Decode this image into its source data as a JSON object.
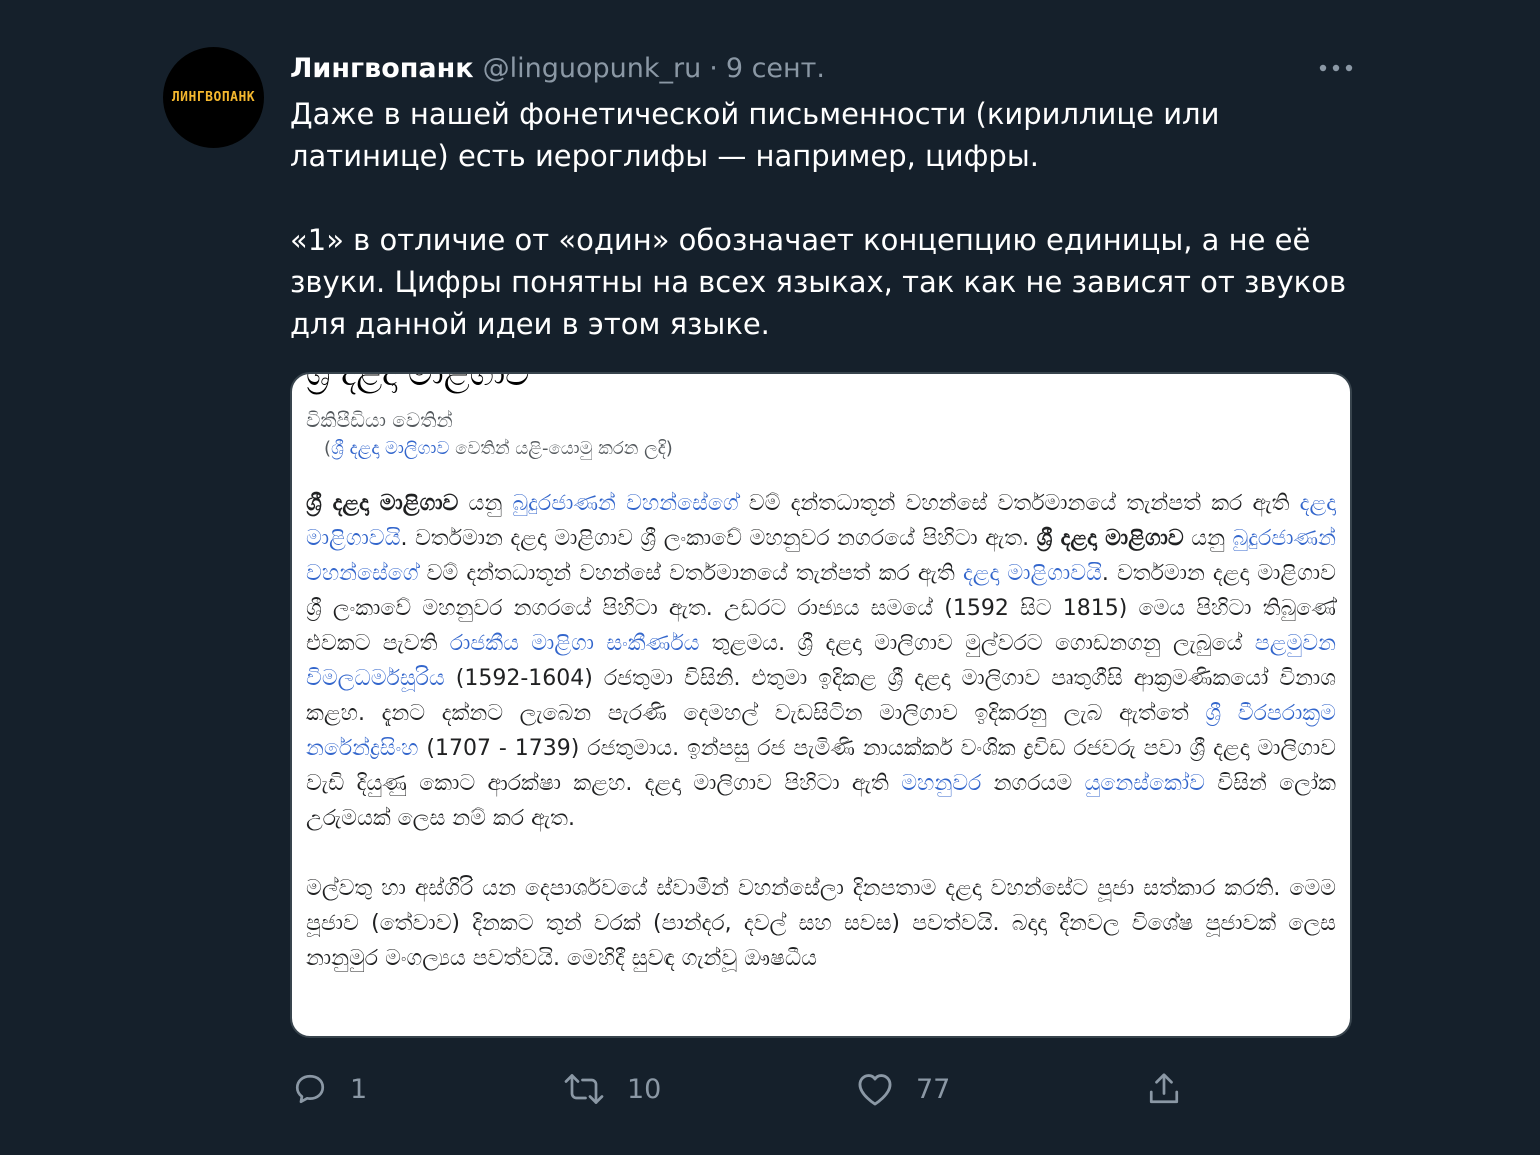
{
  "tweet": {
    "avatar_text": "ЛИНГВОПАНК",
    "author_name": "Лингвопанк",
    "handle": "@linguopunk_ru",
    "separator": "·",
    "date": "9 сент.",
    "more_icon": "more-horizontal-icon",
    "paragraphs": [
      "Даже в нашей фонетической письменности (кириллице или латинице) есть иероглифы — например, цифры.",
      "«1» в отличие от «один» обозначает концепцию единицы, а не её звуки. Цифры понятны на всех языках, так как не зависят от звуков для данной идеи в этом языке."
    ]
  },
  "media": {
    "heading_partial": "ශ්‍රී දළදා මාළිගාව",
    "from_line": "විකිපීඩියා වෙතින්",
    "redirect": {
      "open": "(",
      "link": "ශ්‍රී දළදා මාලිගාව",
      "rest": " වෙතින් යළි-යොමු කරන ලදි)"
    },
    "p1": {
      "s1": "ශ්‍රී දළදා මාළිගාව",
      "s2": " යනු ",
      "s3": "බුදුරජාණන් වහන්සේගේ",
      "s4": " වම් දන්තධාතූන් වහන්සේ වර්තමානයේ තැන්පත් කර ඇති ",
      "s5": "දළදා මාළිගාවයි",
      "s6": ". වර්තමාන දළදා මාළිගාව ශ්‍රී ලංකාවේ මහනුවර නගරයේ පිහිටා ඇත. ",
      "s7": "ශ්‍රී දළදා මාළිගාව",
      "s8": " යනු ",
      "s9": "බුදුරජාණන් වහන්සේගේ",
      "s10": " වම් දන්තධාතූන් වහන්සේ වර්තමානයේ තැන්පත් කර ඇති ",
      "s11": "දළදා මාළිගාවයි",
      "s12": ". වර්තමාන දළදා මාළිගාව ශ්‍රී ලංකාවේ මහනුවර නගරයේ පිහිටා ඇත. උඩරට රාජ්‍යය සමයේ (1592 සිට 1815) මෙය පිහිටා තිබුණේ එවකට පැවති ",
      "s13": "රාජකීය මාළිගා සංකීර්ණය",
      "s14": " තුළමය. ශ්‍රී දළදා මාලිගාව මුල්වරට ගොඩනගනු ලැබුයේ ",
      "s15": "පළමුවන විමලධර්මසූරිය",
      "s16": " (1592-1604) රජතුමා විසිනි. එතුමා ඉදිකළ ශ්‍රී දළදා මාලිගාව පෘතුගීසි ආක්‍රමණිකයෝ විනාශ කළහ. දැනට දක්නට ලැබෙන පැරණි දෙමහල් වැඩසිටින මාලිගාව ඉදිකරනු ලැබ ඇත්තේ ",
      "s17": "ශ්‍රී වීරපරාක්‍රම නරේන්ද්‍රසිංහ",
      "s18": " (1707 - 1739) රජතුමාය. ඉන්පසු රජ පැමිණි නායක්කර් වංශික ද්‍රවිඩ රජවරු පවා ශ්‍රී දළදා මාලිගාව වැඩි දියුණු කොට ආරක්ෂා කළහ. දළදා මාලිගාව පිහිටා ඇති ",
      "s19": "මහනුවර",
      "s20": " නගරයම ",
      "s21": "යුනෙස්කෝව",
      "s22": " විසින් ලෝක උරුමයක් ලෙස නම් කර ඇත."
    },
    "p2": "මල්වතු හා අස්ගිරි යන දෙපාර්ශවයේ ස්වාමීන් වහන්සේලා දිනපතාම දළදා වහන්සේට පූජා සත්කාර කරති. මෙම පූජාව (තේවාව) දිනකට තුන් වරක් (පාන්දර, දවල් සහ සවස) පවත්වයි. බදාදා දිනවල විශේෂ පූජාවක් ලෙස නානුමුර මංගල්‍යය පවත්වයි. මෙහිදී සුවඳ ගැන්වූ ඖෂධීය"
  },
  "actions": {
    "reply": {
      "icon": "reply-icon",
      "count": "1"
    },
    "retweet": {
      "icon": "retweet-icon",
      "count": "10"
    },
    "like": {
      "icon": "heart-icon",
      "count": "77"
    },
    "share": {
      "icon": "share-icon"
    }
  },
  "colors": {
    "background": "#15202b",
    "text_primary": "#ffffff",
    "text_secondary": "#8b98a5",
    "border": "#38444d",
    "avatar_text": "#f5b82e",
    "wiki_link": "#3366cc"
  }
}
